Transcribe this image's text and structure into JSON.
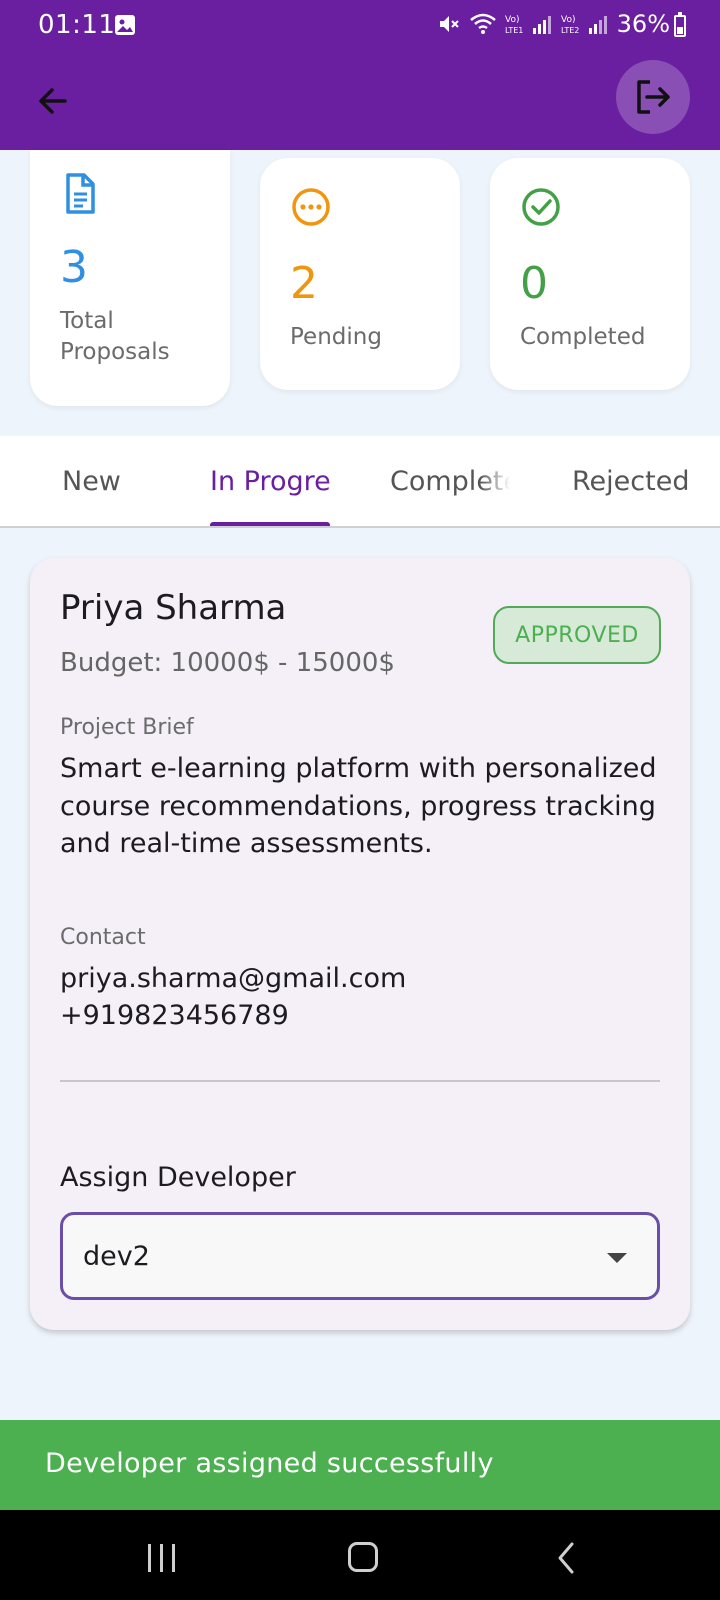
{
  "status_bar": {
    "time": "01:11",
    "battery": "36%"
  },
  "app_bar": {
    "back_icon": "arrow-left-icon",
    "logout_icon": "logout-icon"
  },
  "stats": [
    {
      "value": "3",
      "label": "Total Proposals",
      "icon": "document-icon",
      "color": "#2f8fe0"
    },
    {
      "value": "2",
      "label": "Pending",
      "icon": "pending-dots-icon",
      "color": "#f0960e"
    },
    {
      "value": "0",
      "label": "Completed",
      "icon": "check-circle-icon",
      "color": "#43a047"
    }
  ],
  "tabs": [
    {
      "label": "New"
    },
    {
      "label": "In Progress"
    },
    {
      "label": "Completed"
    },
    {
      "label": "Rejected"
    }
  ],
  "proposal": {
    "client_name": "Priya Sharma",
    "budget": "Budget: 10000$ - 15000$",
    "status": "APPROVED",
    "brief_label": "Project Brief",
    "brief": "Smart e-learning platform with personalized course recommendations, progress tracking and real-time assessments.",
    "contact_label": "Contact",
    "email": "priya.sharma@gmail.com",
    "phone": "+919823456789",
    "assign_label": "Assign Developer",
    "assigned_developer": "dev2"
  },
  "snackbar": {
    "message": "Developer assigned successfully"
  },
  "colors": {
    "primary": "#6a1fa0",
    "success": "#4caf50"
  }
}
